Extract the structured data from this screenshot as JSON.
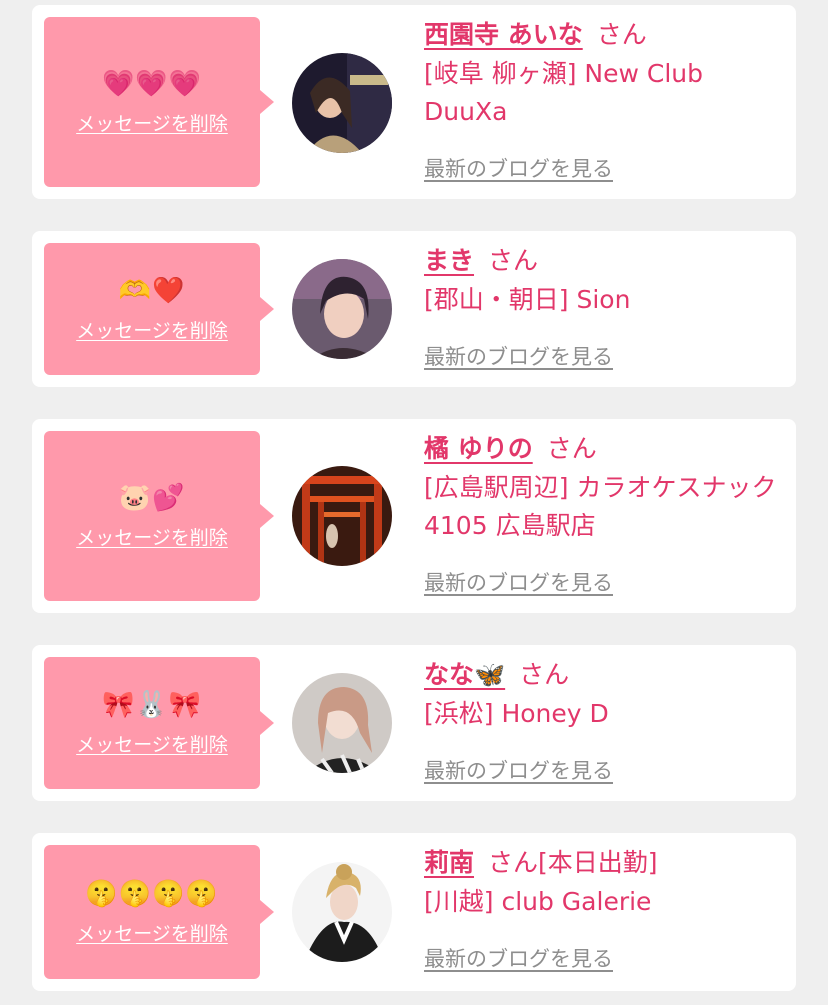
{
  "delete_label": "メッセージを削除",
  "blog_label": "最新のブログを見る",
  "san_label": "さん",
  "colors": {
    "bubble": "#ff99ab",
    "accent": "#e2376a",
    "link_gray": "#8e8e8e",
    "background": "#efefef"
  },
  "items": [
    {
      "stamp": "💗💗💗",
      "name": "西園寺 あいな",
      "san": "さん",
      "shop": "[岐阜 柳ヶ瀬] New Club DuuXa",
      "avatar_icon": "photo-avatar"
    },
    {
      "stamp": "🫶❤️",
      "name": "まき",
      "san": "さん",
      "shop": "[郡山・朝日] Sion",
      "avatar_icon": "photo-avatar"
    },
    {
      "stamp": "🐷💕",
      "name": "橘 ゆりの",
      "san": "さん",
      "shop": "[広島駅周辺] カラオケスナック 4105 広島駅店",
      "avatar_icon": "photo-avatar"
    },
    {
      "stamp": "🎀🐰🎀",
      "name": "なな🦋",
      "san": "さん",
      "shop": "[浜松] Honey D",
      "avatar_icon": "photo-avatar"
    },
    {
      "stamp": "🤫🤫🤫🤫",
      "name": "莉南",
      "san": "さん[本日出勤]",
      "shop": "[川越] club Galerie",
      "avatar_icon": "photo-avatar"
    }
  ]
}
